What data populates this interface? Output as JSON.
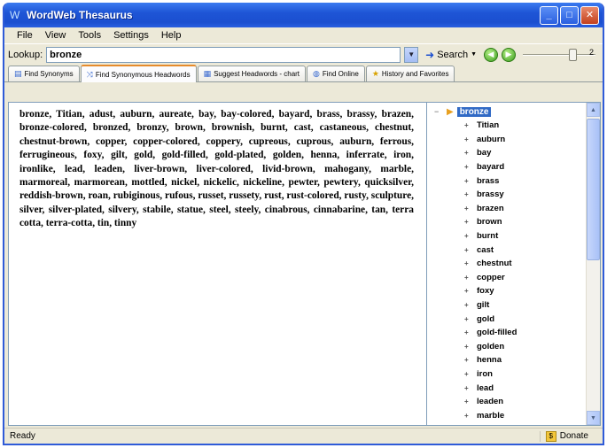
{
  "window": {
    "title": "WordWeb Thesaurus"
  },
  "menu": [
    "File",
    "View",
    "Tools",
    "Settings",
    "Help"
  ],
  "lookup": {
    "label": "Lookup:",
    "value": "bronze",
    "search_label": "Search",
    "slider_value": "2"
  },
  "tabs": [
    {
      "label": "Find Synonyms",
      "icon": "book-icon"
    },
    {
      "label": "Find Synonymous Headwords",
      "icon": "arrows-icon"
    },
    {
      "label": "Suggest Headwords - chart",
      "icon": "chart-icon"
    },
    {
      "label": "Find Online",
      "icon": "globe-icon"
    },
    {
      "label": "History and Favorites",
      "icon": "star-icon"
    }
  ],
  "synonyms_text": "bronze, Titian, adust, auburn, aureate, bay, bay-colored, bayard, brass, brassy, brazen, bronze-colored, bronzed, bronzy, brown, brownish, burnt, cast, castaneous, chestnut, chestnut-brown, copper, copper-colored, coppery, cupreous, cuprous, auburn, ferrous, ferrugineous, foxy, gilt, gold, gold-filled, gold-plated, golden, henna, inferrate, iron, ironlike, lead, leaden, liver-brown, liver-colored, livid-brown, mahogany, marble, marmoreal, marmorean, mottled, nickel, nickelic, nickeline, pewter, pewtery, quicksilver, reddish-brown, roan, rubiginous, rufous, russet, russety, rust, rust-colored, rusty, sculpture, silver, silver-plated, silvery, stabile, statue, steel, steely, cinabrous, cinnabarine, tan, terra cotta, terra-cotta, tin, tinny",
  "tree": {
    "root": "bronze",
    "items": [
      "Titian",
      "auburn",
      "bay",
      "bayard",
      "brass",
      "brassy",
      "brazen",
      "brown",
      "burnt",
      "cast",
      "chestnut",
      "copper",
      "foxy",
      "gilt",
      "gold",
      "gold-filled",
      "golden",
      "henna",
      "iron",
      "lead",
      "leaden",
      "marble"
    ]
  },
  "status": {
    "text": "Ready",
    "donate_label": "Donate"
  }
}
